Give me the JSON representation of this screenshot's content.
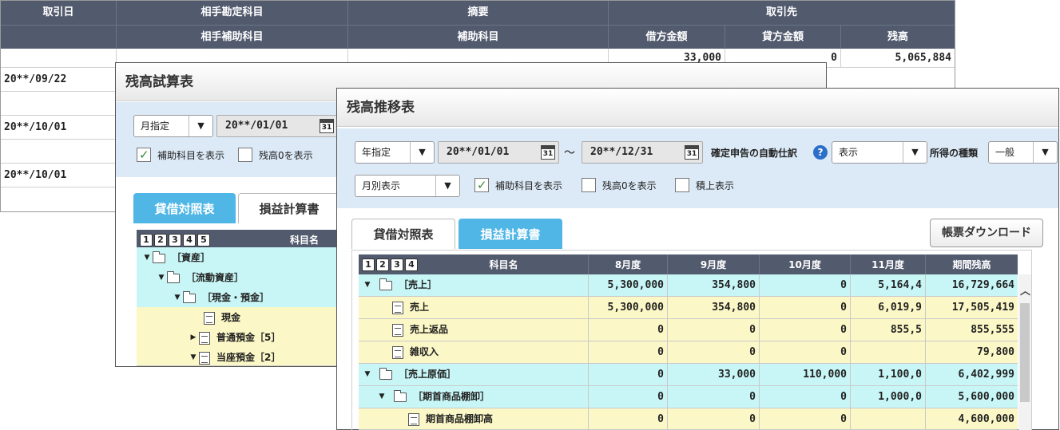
{
  "ledger": {
    "header1": [
      "取引日",
      "相手勘定科目",
      "摘要",
      "取引先"
    ],
    "header2": [
      "",
      "相手補助科目",
      "補助科目",
      "借方金額",
      "貸方金額",
      "残高"
    ],
    "first_row": {
      "debit": "33,000",
      "credit": "0",
      "balance": "5,065,884"
    },
    "dates": [
      "20**/09/22",
      "20**/10/01",
      "20**/10/01"
    ]
  },
  "trial": {
    "title": "残高試算表",
    "period_select": "月指定",
    "date": "20**/01/01",
    "cal_icon": "31",
    "chk_sub": "補助科目を表示",
    "chk_zero": "残高0を表示",
    "tabs": [
      "貸借対照表",
      "損益計算書"
    ],
    "levels": [
      "1",
      "2",
      "3",
      "4",
      "5"
    ],
    "col_name": "科目名",
    "rows": [
      {
        "label": "［資産］"
      },
      {
        "label": "［流動資産］"
      },
      {
        "label": "［現金・預金］"
      },
      {
        "label": "現金"
      },
      {
        "label": "普通預金［5］"
      },
      {
        "label": "当座預金［2］"
      }
    ]
  },
  "trend": {
    "title": "残高推移表",
    "period_select": "年指定",
    "date_from": "20**/01/01",
    "tilde": "～",
    "date_to": "20**/12/31",
    "cal_icon": "31",
    "auto_label": "確定申告の自動仕訳",
    "auto_select": "表示",
    "income_label": "所得の種類",
    "income_select": "一般",
    "view_select": "月別表示",
    "chk_sub": "補助科目を表示",
    "chk_zero": "残高0を表示",
    "chk_cum": "積上表示",
    "tabs": [
      "貸借対照表",
      "損益計算書"
    ],
    "download": "帳票ダウンロード",
    "levels": [
      "1",
      "2",
      "3",
      "4"
    ],
    "columns": [
      "科目名",
      "8月度",
      "9月度",
      "10月度",
      "11月度",
      "期間残高"
    ],
    "rows": [
      {
        "label": "［売上］",
        "vals": [
          "5,300,000",
          "354,800",
          "0",
          "5,164,4",
          "16,729,664"
        ]
      },
      {
        "label": "売上",
        "vals": [
          "5,300,000",
          "354,800",
          "0",
          "6,019,9",
          "17,505,419"
        ]
      },
      {
        "label": "売上返品",
        "vals": [
          "0",
          "0",
          "0",
          "855,5",
          "855,555"
        ]
      },
      {
        "label": "雑収入",
        "vals": [
          "0",
          "0",
          "0",
          "",
          "79,800"
        ]
      },
      {
        "label": "［売上原価］",
        "vals": [
          "0",
          "33,000",
          "110,000",
          "1,100,0",
          "6,402,999"
        ]
      },
      {
        "label": "［期首商品棚卸］",
        "vals": [
          "0",
          "0",
          "0",
          "1,000,0",
          "5,600,000"
        ]
      },
      {
        "label": "期首商品棚卸高",
        "vals": [
          "0",
          "0",
          "0",
          "",
          "4,600,000"
        ]
      }
    ]
  }
}
